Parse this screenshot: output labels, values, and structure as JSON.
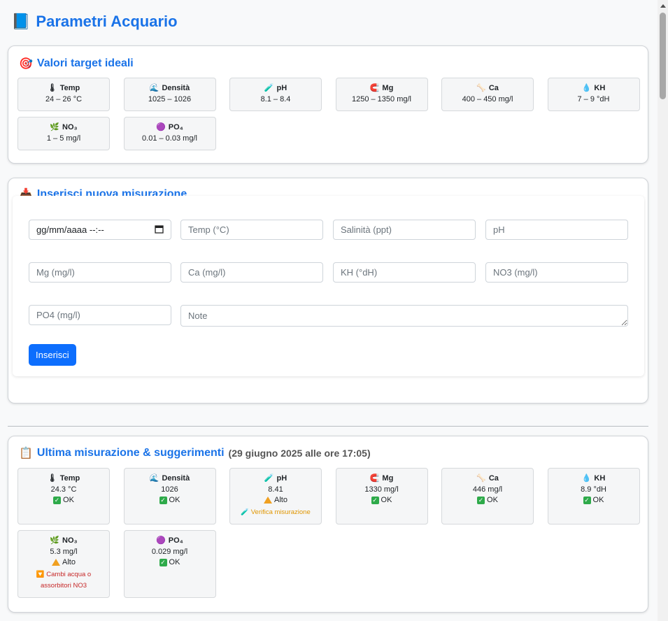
{
  "page": {
    "title": "Parametri Acquario"
  },
  "targets": {
    "title": "Valori target ideali",
    "params": [
      {
        "icon": "🌡",
        "name": "Temp",
        "value": "24 – 26 °C"
      },
      {
        "icon": "🌊",
        "name": "Densità",
        "value": "1025 – 1026"
      },
      {
        "icon": "🧪",
        "name": "pH",
        "value": "8.1 – 8.4"
      },
      {
        "icon": "🧲",
        "name": "Mg",
        "value": "1250 – 1350 mg/l"
      },
      {
        "icon": "🦴",
        "name": "Ca",
        "value": "400 – 450 mg/l"
      },
      {
        "icon": "💧",
        "name": "KH",
        "value": "7 – 9 °dH"
      },
      {
        "icon": "🌿",
        "name": "NO₃",
        "value": "1 – 5 mg/l"
      },
      {
        "icon": "🟣",
        "name": "PO₄",
        "value": "0.01 – 0.03 mg/l"
      }
    ]
  },
  "form": {
    "title": "Inserisci nuova misurazione",
    "date_value": "gg/mm/aaaa --:--",
    "placeholders": {
      "temp": "Temp (°C)",
      "salinity": "Salinità (ppt)",
      "ph": "pH",
      "mg": "Mg (mg/l)",
      "ca": "Ca (mg/l)",
      "kh": "KH (°dH)",
      "no3": "NO3 (mg/l)",
      "po4": "PO4 (mg/l)",
      "note": "Note"
    },
    "submit_label": "Inserisci"
  },
  "latest": {
    "title": "Ultima misurazione & suggerimenti",
    "date": "(29 giugno 2025 alle ore 17:05)",
    "params": [
      {
        "icon": "🌡",
        "name": "Temp",
        "value": "24.3 °C",
        "status": "OK",
        "level": "ok"
      },
      {
        "icon": "🌊",
        "name": "Densità",
        "value": "1026",
        "status": "OK",
        "level": "ok"
      },
      {
        "icon": "🧪",
        "name": "pH",
        "value": "8.41",
        "status": "Alto",
        "level": "warn",
        "hint": "🧪 Verifica misurazione",
        "hint_color": "orange"
      },
      {
        "icon": "🧲",
        "name": "Mg",
        "value": "1330 mg/l",
        "status": "OK",
        "level": "ok"
      },
      {
        "icon": "🦴",
        "name": "Ca",
        "value": "446 mg/l",
        "status": "OK",
        "level": "ok"
      },
      {
        "icon": "💧",
        "name": "KH",
        "value": "8.9 °dH",
        "status": "OK",
        "level": "ok"
      },
      {
        "icon": "🌿",
        "name": "NO₃",
        "value": "5.3 mg/l",
        "status": "Alto",
        "level": "warn",
        "hint": "🔽 Cambi acqua o assorbitori NO3",
        "hint_color": "red"
      },
      {
        "icon": "🟣",
        "name": "PO₄",
        "value": "0.029 mg/l",
        "status": "OK",
        "level": "ok"
      }
    ]
  },
  "colors": {
    "accent": "#1a73e8",
    "button": "#0d6efd",
    "ok": "#2eaa4a",
    "warn": "#f0a020",
    "hint_orange": "#e09600",
    "hint_red": "#c62828"
  }
}
